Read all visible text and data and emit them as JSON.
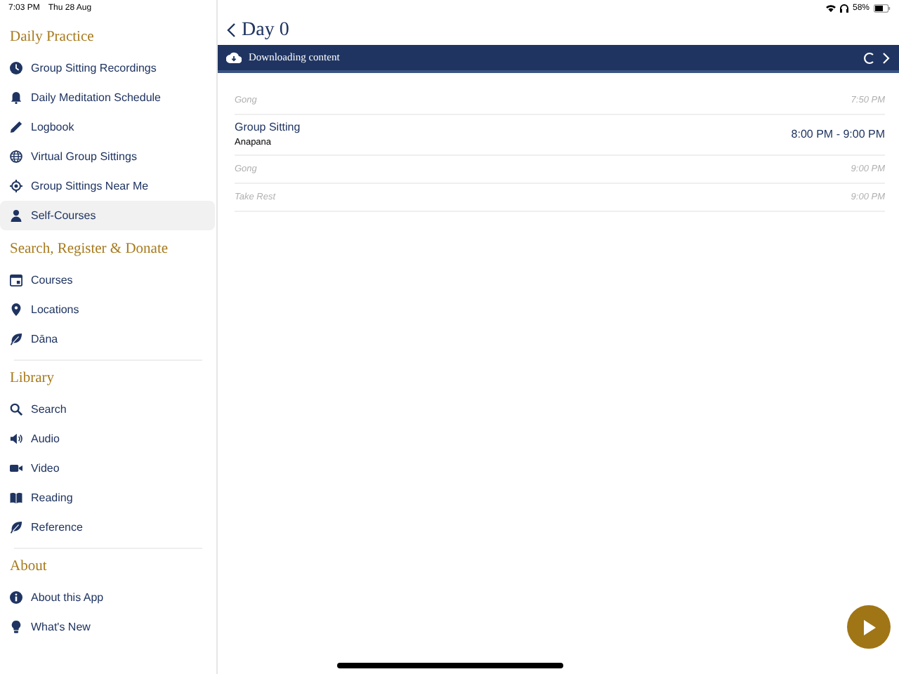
{
  "status_bar": {
    "time": "7:03 PM",
    "date": "Thu 28 Aug",
    "battery": "58%"
  },
  "sidebar": {
    "sections": [
      {
        "title": "Daily Practice",
        "items": [
          {
            "label": "Group Sitting Recordings",
            "selected": false
          },
          {
            "label": "Daily Meditation Schedule",
            "selected": false
          },
          {
            "label": "Logbook",
            "selected": false
          },
          {
            "label": "Virtual Group Sittings",
            "selected": false
          },
          {
            "label": "Group Sittings Near Me",
            "selected": false
          },
          {
            "label": "Self-Courses",
            "selected": true
          }
        ]
      },
      {
        "title": "Search, Register & Donate",
        "items": [
          {
            "label": "Courses",
            "selected": false
          },
          {
            "label": "Locations",
            "selected": false
          },
          {
            "label": "Dāna",
            "selected": false
          }
        ]
      },
      {
        "title": "Library",
        "items": [
          {
            "label": "Search",
            "selected": false
          },
          {
            "label": "Audio",
            "selected": false
          },
          {
            "label": "Video",
            "selected": false
          },
          {
            "label": "Reading",
            "selected": false
          },
          {
            "label": "Reference",
            "selected": false
          }
        ]
      },
      {
        "title": "About",
        "items": [
          {
            "label": "About this App",
            "selected": false
          },
          {
            "label": "What's New",
            "selected": false
          }
        ]
      }
    ]
  },
  "page": {
    "title": "Day 0",
    "banner": "Downloading content",
    "schedule": [
      {
        "kind": "minor",
        "title": "Gong",
        "time": "7:50 PM"
      },
      {
        "kind": "session",
        "title": "Group Sitting",
        "subtitle": "Anapana",
        "time": "8:00 PM - 9:00 PM"
      },
      {
        "kind": "minor",
        "title": "Gong",
        "time": "9:00 PM"
      },
      {
        "kind": "minor",
        "title": "Take Rest",
        "time": "9:00 PM"
      }
    ]
  }
}
